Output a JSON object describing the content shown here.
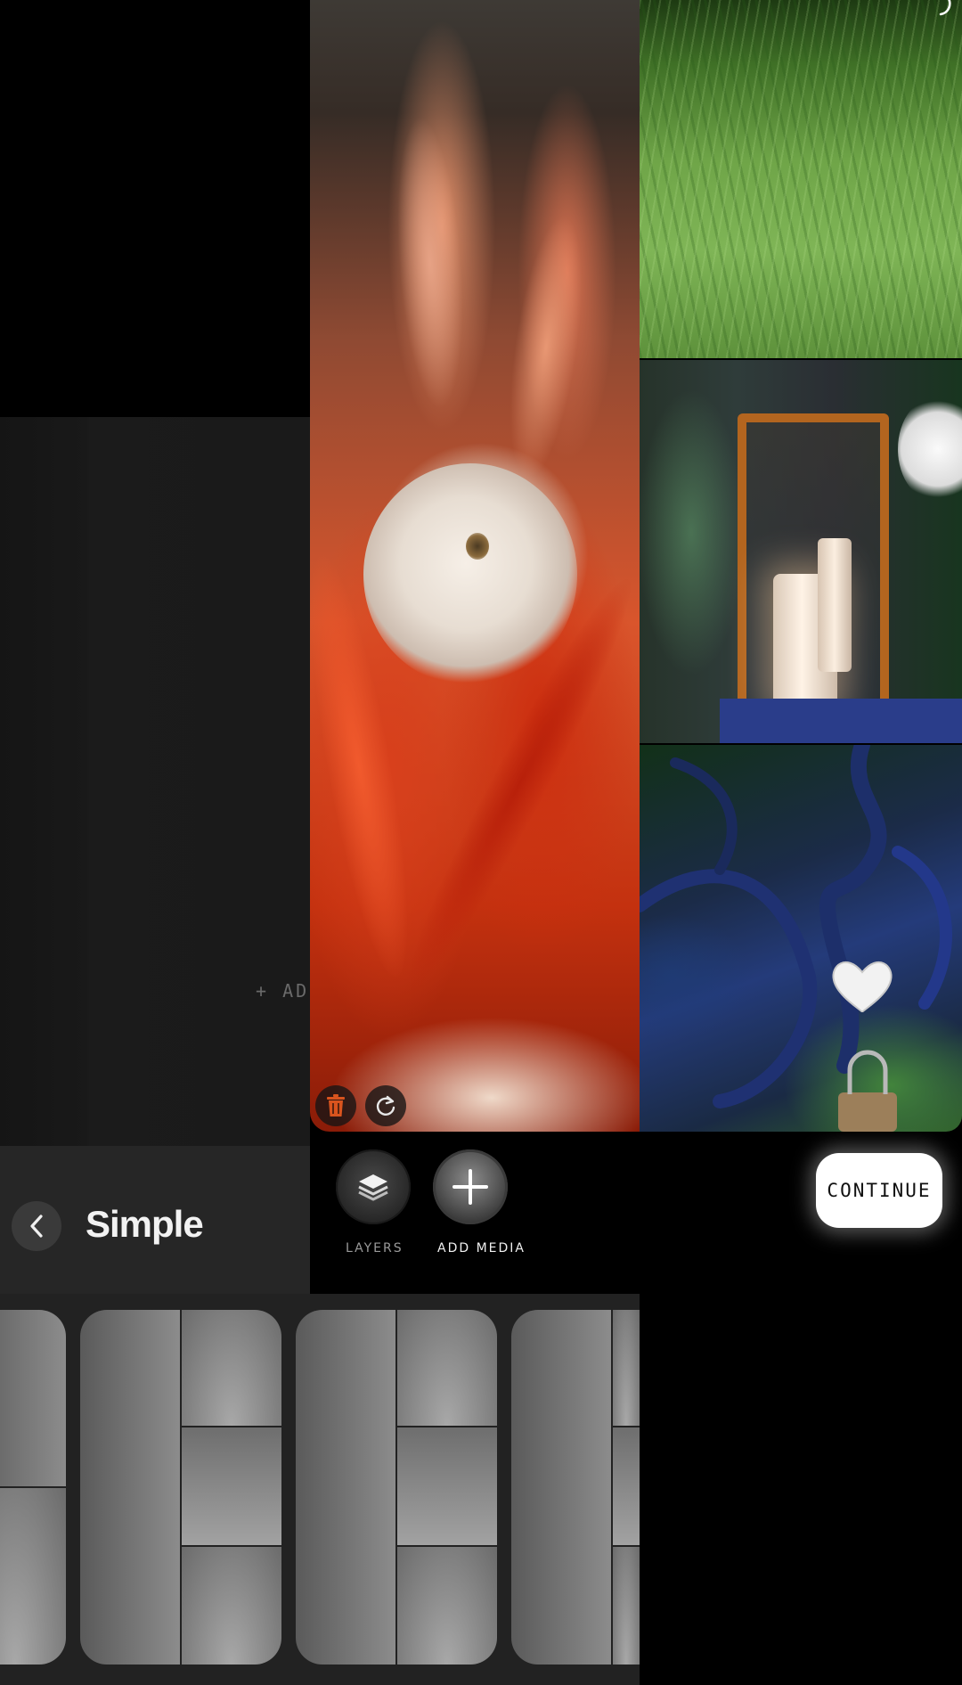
{
  "canvas": {
    "add_slot_label": "+ ADD",
    "photos": [
      "flower",
      "grass",
      "lantern",
      "heart-lock"
    ]
  },
  "toolbar": {
    "layers_label": "LAYERS",
    "add_media_label": "ADD MEDIA",
    "continue_label": "CONTINUE"
  },
  "layout_panel": {
    "title": "Simple",
    "thumbnails": [
      "layout-split-bottom",
      "layout-left-plus-three",
      "layout-left-plus-three-alt",
      "layout-partial"
    ]
  },
  "icons": {
    "undo": "undo-icon",
    "delete": "trash-icon",
    "rotate": "rotate-icon",
    "back": "chevron-left-icon",
    "layers": "layers-icon",
    "add": "plus-icon"
  },
  "colors": {
    "background": "#000000",
    "panel": "#262626",
    "accent_button": "#ffffff"
  }
}
